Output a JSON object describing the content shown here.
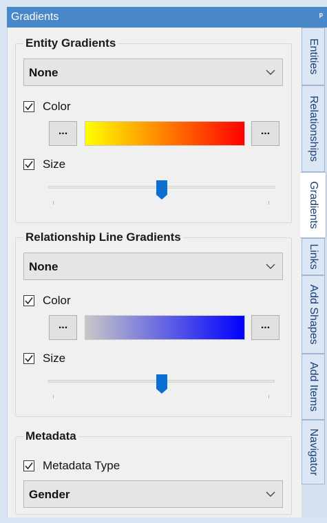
{
  "window": {
    "title": "Gradients",
    "pin_icon": "pin-icon"
  },
  "tabs": [
    {
      "label": "Entities"
    },
    {
      "label": "Relationships"
    },
    {
      "label": "Gradients"
    },
    {
      "label": "Links"
    },
    {
      "label": "Add Shapes"
    },
    {
      "label": "Add Items"
    },
    {
      "label": "Navigator"
    }
  ],
  "entity_gradients": {
    "title": "Entity Gradients",
    "dropdown_value": "None",
    "color_label": "Color",
    "color_checked": true,
    "left_button": "...",
    "right_button": "...",
    "gradient_from": "#ffff00",
    "gradient_to": "#ff0000",
    "size_label": "Size",
    "size_checked": true,
    "slider_value": 0.5
  },
  "relationship_gradients": {
    "title": "Relationship Line Gradients",
    "dropdown_value": "None",
    "color_label": "Color",
    "color_checked": true,
    "left_button": "...",
    "right_button": "...",
    "gradient_from": "#c8c8c8",
    "gradient_to": "#0000ff",
    "size_label": "Size",
    "size_checked": true,
    "slider_value": 0.5
  },
  "metadata": {
    "title": "Metadata",
    "type_label": "Metadata Type",
    "type_checked": true,
    "dropdown_value": "Gender"
  },
  "colors": {
    "accent": "#4a87c7",
    "slider_thumb": "#0a6fd1"
  }
}
